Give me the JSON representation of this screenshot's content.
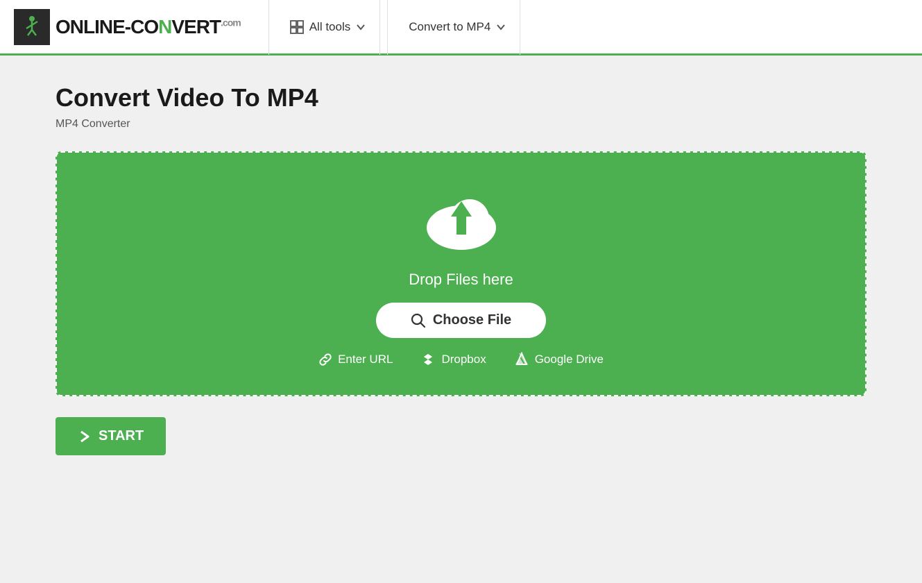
{
  "header": {
    "logo_brand": "ONLINE-CONVERT",
    "logo_com": ".com",
    "nav_all_tools": "All tools",
    "nav_convert_to": "Convert to MP4"
  },
  "main": {
    "page_title": "Convert Video To MP4",
    "page_subtitle": "MP4 Converter",
    "upload": {
      "drop_text": "Drop Files here",
      "choose_file_label": "Choose File",
      "enter_url_label": "Enter URL",
      "dropbox_label": "Dropbox",
      "google_drive_label": "Google Drive"
    },
    "start_button_label": "START"
  }
}
